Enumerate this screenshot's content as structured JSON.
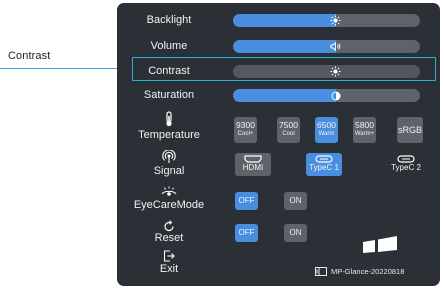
{
  "callout": {
    "label": "Contrast"
  },
  "menu": {
    "backlight": {
      "label": "Backlight",
      "value_pct": 55
    },
    "volume": {
      "label": "Volume",
      "value_pct": 55
    },
    "contrast": {
      "label": "Contrast",
      "value_pct": 55
    },
    "saturation": {
      "label": "Saturation",
      "value_pct": 55
    },
    "temperature": {
      "label": "Temperature",
      "options": [
        {
          "value": "9300",
          "sub": "Cool+"
        },
        {
          "value": "7500",
          "sub": "Cool"
        },
        {
          "value": "6500",
          "sub": "Warm"
        },
        {
          "value": "5800",
          "sub": "Warm+"
        }
      ],
      "srgb": "sRGB",
      "selected": "6500"
    },
    "signal": {
      "label": "Signal",
      "options": [
        "HDMI",
        "TypeC 1",
        "TypeC 2"
      ],
      "selected": "TypeC 1"
    },
    "eyecare": {
      "label": "EyeCareMode",
      "off": "OFF",
      "on": "ON",
      "selected": "OFF"
    },
    "reset": {
      "label": "Reset",
      "off": "OFF",
      "on": "ON",
      "selected": "OFF"
    },
    "exit": {
      "label": "Exit"
    }
  },
  "footer": {
    "version": "MP-Glance-20220818"
  },
  "colors": {
    "accent": "#4a8ee0",
    "panel": "#2b3036",
    "control": "#5d6369",
    "highlight": "#2bb0d6"
  }
}
